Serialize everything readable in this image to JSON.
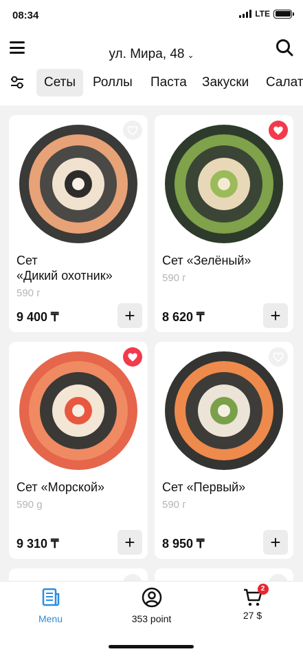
{
  "status": {
    "time": "08:34",
    "network": "LTE"
  },
  "header": {
    "address": "ул. Мира, 48"
  },
  "tabs": [
    "Сеты",
    "Роллы",
    "Паста",
    "Закуски",
    "Салаты"
  ],
  "products": [
    {
      "title_line1": "Сет",
      "title_line2": "«Дикий охотник»",
      "weight": "590 г",
      "price": "9 400 ₸",
      "favorite": false,
      "plate": "assorted-sushi-image"
    },
    {
      "title_line1": "Сет «Зелёный»",
      "title_line2": "",
      "weight": "590 г",
      "price": "8 620 ₸",
      "favorite": true,
      "plate": "green-sushi-image"
    },
    {
      "title_line1": "Сет «Морской»",
      "title_line2": "",
      "weight": "590 g",
      "price": "9 310 ₸",
      "favorite": true,
      "plate": "salmon-sushi-image"
    },
    {
      "title_line1": "Сет «Первый»",
      "title_line2": "",
      "weight": "590 г",
      "price": "8 950 ₸",
      "favorite": false,
      "plate": "maki-sushi-image"
    }
  ],
  "bottom_nav": {
    "menu": "Menu",
    "points": "353 point",
    "cart": "27 $",
    "cart_count": "2"
  },
  "colors": {
    "accent": "#2a8de0",
    "favorite": "#f23a4b",
    "badge": "#e8262f"
  }
}
